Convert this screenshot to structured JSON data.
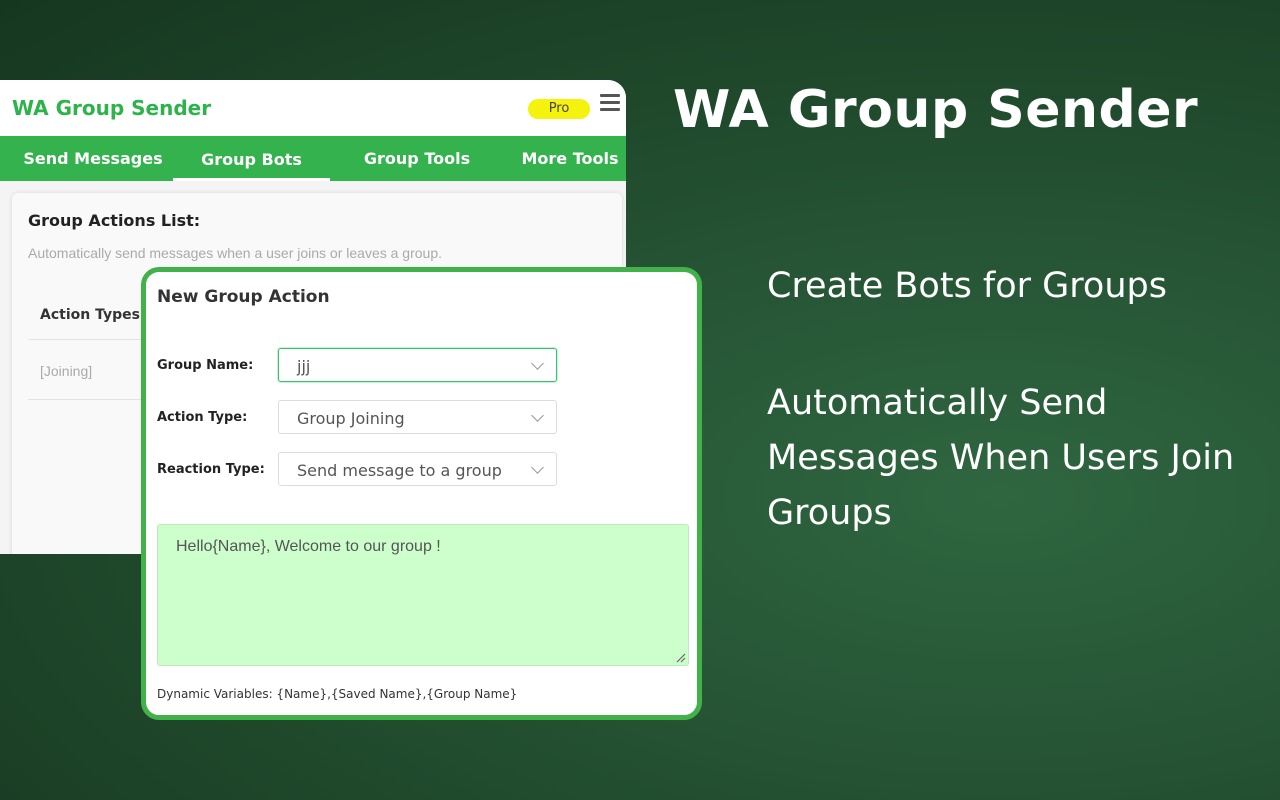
{
  "app": {
    "title": "WA Group Sender",
    "badge": "Pro",
    "menu_icon": "hamburger-menu-icon"
  },
  "tabs": [
    {
      "label": "Send Messages",
      "active": false
    },
    {
      "label": "Group Bots",
      "active": true
    },
    {
      "label": "Group Tools",
      "active": false
    },
    {
      "label": "More Tools",
      "active": false
    }
  ],
  "list_card": {
    "title": "Group Actions List:",
    "subtitle": "Automatically send messages when a user joins or leaves a group.",
    "column_header": "Action Types",
    "rows": [
      "[Joining]"
    ]
  },
  "dialog": {
    "title": "New Group Action",
    "fields": {
      "group_name": {
        "label": "Group Name:",
        "value": "jjj"
      },
      "action_type": {
        "label": "Action Type:",
        "value": "Group Joining"
      },
      "reaction_type": {
        "label": "Reaction Type:",
        "value": "Send message to a group"
      }
    },
    "message": "Hello{Name},  Welcome to our group !",
    "dynamic_vars": "Dynamic Variables: {Name},{Saved Name},{Group Name}"
  },
  "promo": {
    "title": "WA Group Sender",
    "line1": "Create Bots for Groups",
    "line2": "Automatically Send Messages When Users Join Groups"
  },
  "colors": {
    "brand_green": "#33b24d",
    "title_green": "#2db34a",
    "badge_yellow": "#f5f20e",
    "textarea_bg": "#ccffcc",
    "dialog_border": "#43b149"
  }
}
